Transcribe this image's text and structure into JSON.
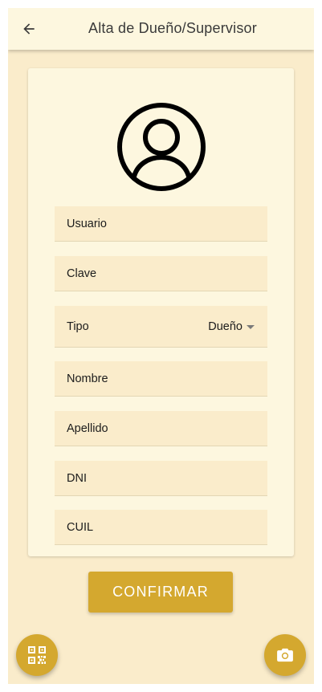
{
  "toolbar": {
    "title": "Alta de Dueño/Supervisor",
    "back_icon": "arrow-back-icon"
  },
  "form": {
    "avatar_icon": "user-avatar-icon",
    "fields": {
      "usuario": "Usuario",
      "clave": "Clave",
      "tipo": "Tipo",
      "nombre": "Nombre",
      "apellido": "Apellido",
      "dni": "DNI",
      "cuil": "CUIL"
    },
    "tipo_selected": "Dueño",
    "confirm_label": "CONFIRMAR"
  },
  "fabs": {
    "left_icon": "qr-code-icon",
    "right_icon": "camera-icon"
  },
  "colors": {
    "background": "#faeccb",
    "card": "#fdf7df",
    "toolbar": "#fdf7df",
    "accent": "#d4a82f"
  }
}
